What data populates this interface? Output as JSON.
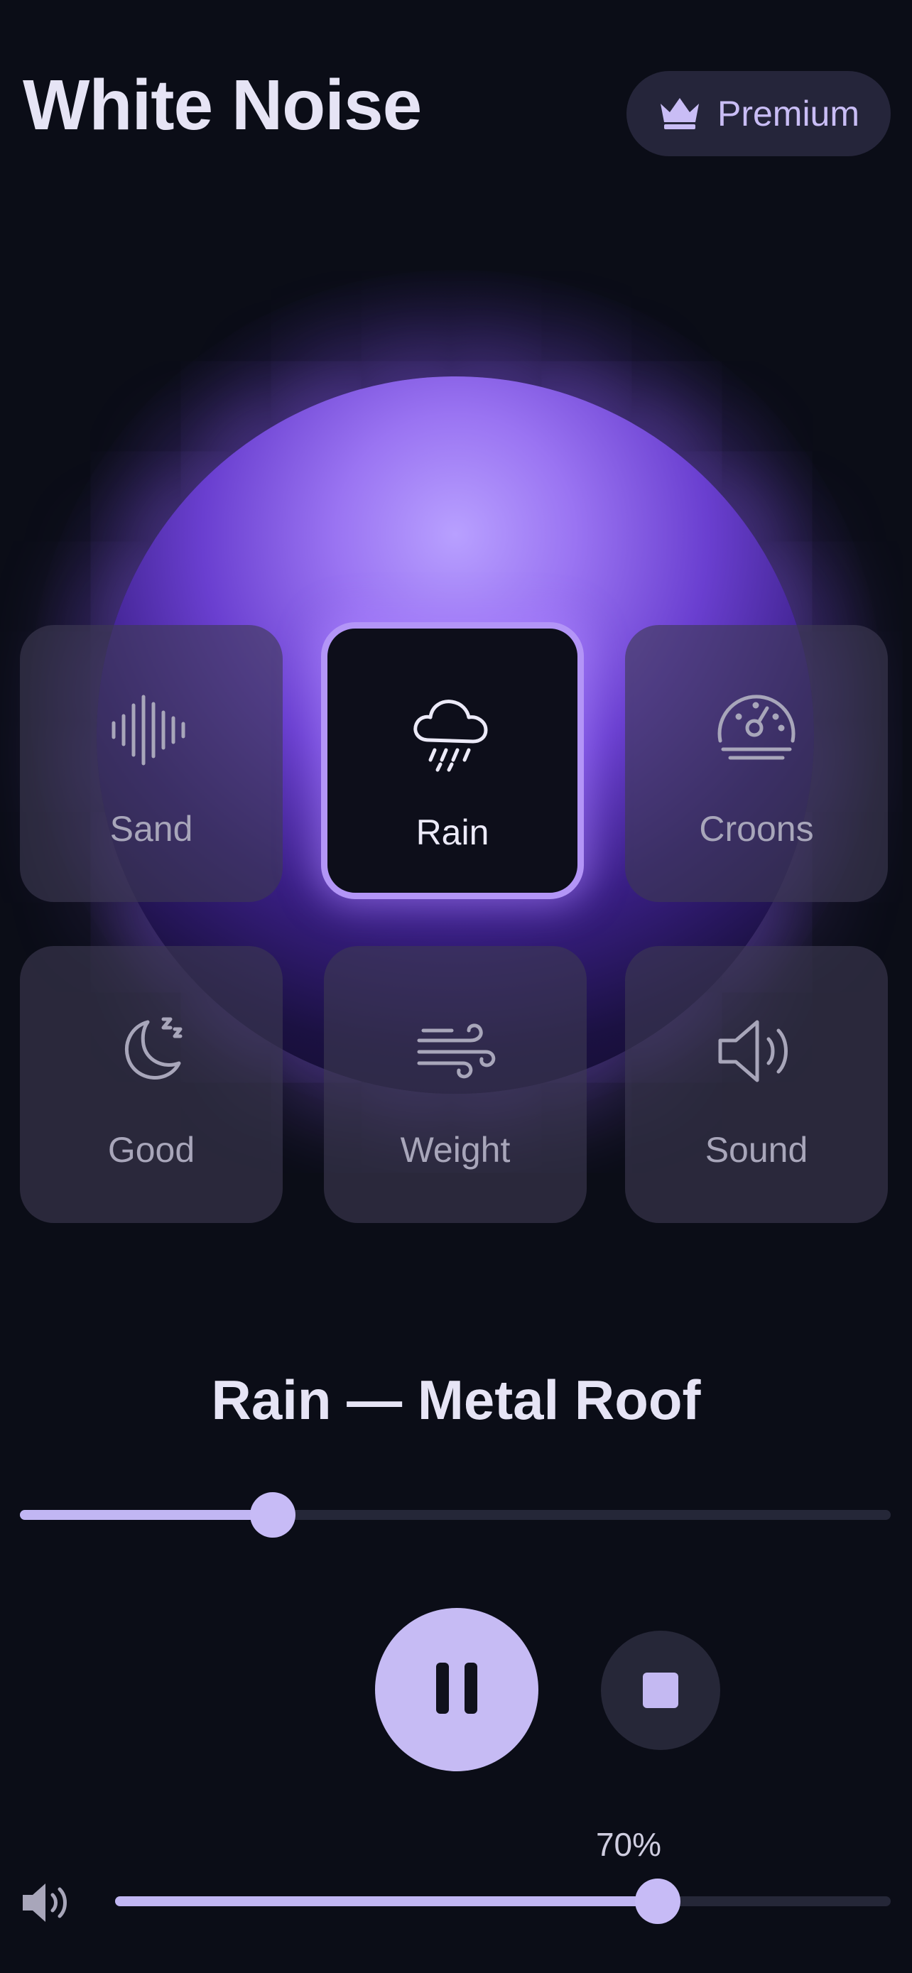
{
  "header": {
    "title": "White Noise",
    "premium_label": "Premium",
    "premium_icon": "crown-icon"
  },
  "sounds": [
    {
      "label": "Sand",
      "icon": "waveform-icon",
      "active": false
    },
    {
      "label": "Rain",
      "icon": "rain-cloud-icon",
      "active": true
    },
    {
      "label": "Croons",
      "icon": "dial-icon",
      "active": false
    },
    {
      "label": "Good",
      "icon": "moon-sleep-icon",
      "active": false
    },
    {
      "label": "Weight",
      "icon": "wind-icon",
      "active": false
    },
    {
      "label": "Sound",
      "icon": "speaker-icon",
      "active": false
    }
  ],
  "player": {
    "track_title": "Rain — Metal Roof",
    "progress_fraction": 0.29,
    "pause_icon": "pause-icon",
    "stop_icon": "stop-icon"
  },
  "volume": {
    "label": "70%",
    "value_fraction": 0.7,
    "icon": "volume-icon"
  },
  "colors": {
    "background": "#0b0d17",
    "accent": "#b395f7",
    "accent_light": "#c6bbf4",
    "tile": "#3e3a52"
  }
}
